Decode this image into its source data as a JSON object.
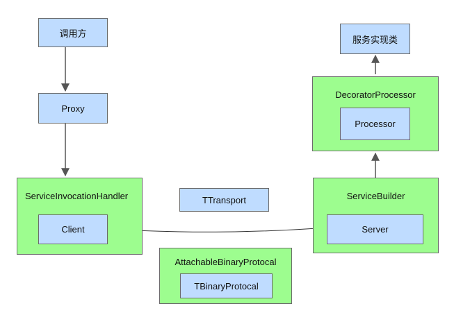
{
  "nodes": {
    "caller": "调用方",
    "proxy": "Proxy",
    "service_impl": "服务实现类",
    "decorator_processor": "DecoratorProcessor",
    "processor": "Processor",
    "service_invocation_handler": "ServiceInvocationHandler",
    "client": "Client",
    "ttransport": "TTransport",
    "service_builder": "ServiceBuilder",
    "server": "Server",
    "attachable_binary_protocal": "AttachableBinaryProtocal",
    "tbinary_protocal": "TBinaryProtocal"
  },
  "colors": {
    "blue_fill": "#bfdcff",
    "green_fill": "#9dfd8f",
    "border": "#6b6b6b",
    "connector": "#555555"
  }
}
